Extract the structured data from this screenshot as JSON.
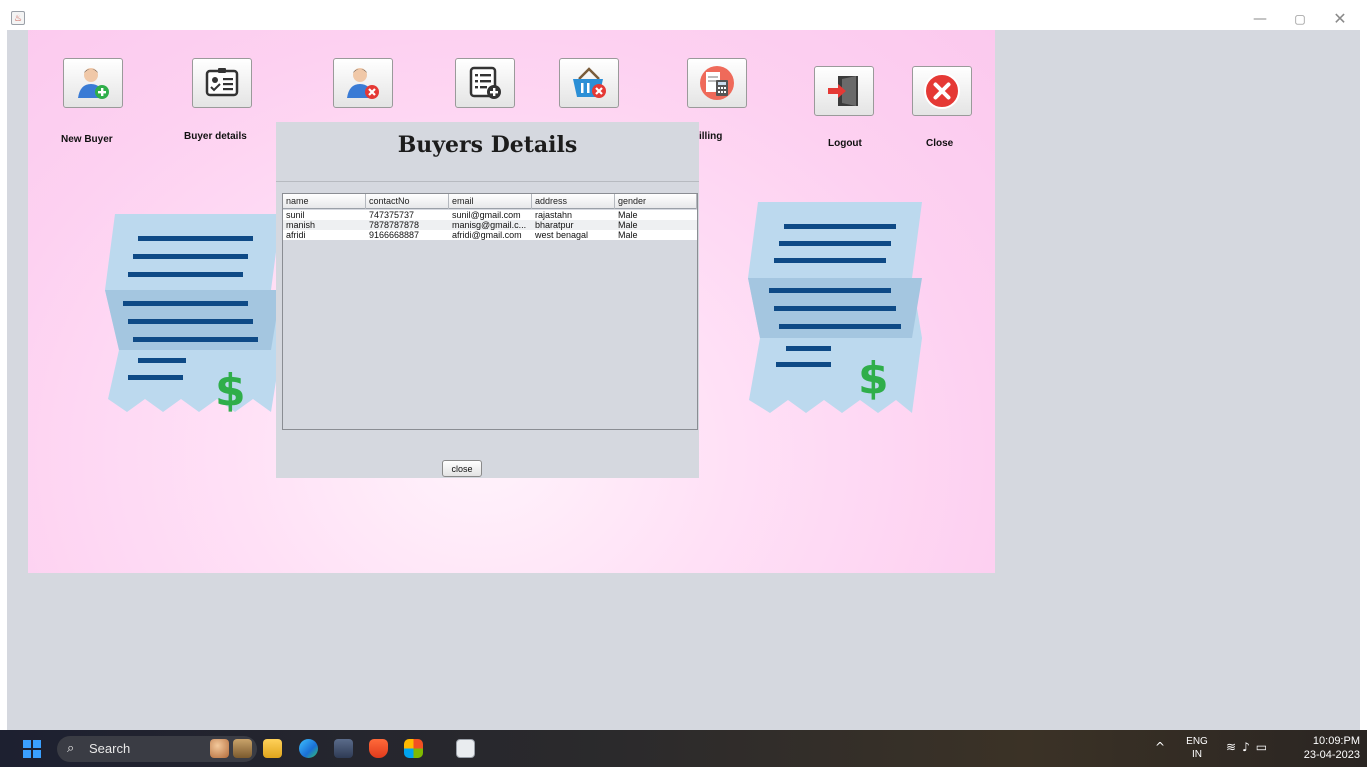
{
  "window": {
    "controls": {
      "minimize": "—",
      "maximize": "▢",
      "close": "✕"
    }
  },
  "toolbar": {
    "buttons": [
      {
        "id": "new-buyer",
        "label": "New Buyer",
        "icon": "add-user-icon"
      },
      {
        "id": "buyer-details",
        "label": "Buyer details",
        "icon": "id-card-icon"
      },
      {
        "id": "delete-buyer",
        "icon": "delete-user-icon"
      },
      {
        "id": "add-product",
        "icon": "add-list-icon"
      },
      {
        "id": "remove-product",
        "icon": "basket-remove-icon"
      },
      {
        "id": "billing",
        "label": "illing",
        "icon": "calculator-icon"
      },
      {
        "id": "logout",
        "label": "Logout",
        "icon": "logout-door-icon"
      },
      {
        "id": "close",
        "label": "Close",
        "icon": "close-circle-icon"
      }
    ]
  },
  "dialog": {
    "title": "Buyers Details",
    "table": {
      "columns": [
        "name",
        "contactNo",
        "email",
        "address",
        "gender"
      ],
      "rows": [
        [
          "sunil",
          "747375737",
          "sunil@gmail.com",
          "rajastahn",
          "Male"
        ],
        [
          "manish",
          "7878787878",
          "manisg@gmail.c...",
          "bharatpur",
          "Male"
        ],
        [
          "afridi",
          "9166668887",
          "afridi@gmail.com",
          "west benagal",
          "Male"
        ]
      ]
    },
    "close_label": "close"
  },
  "taskbar": {
    "search_label": "Search",
    "apps": [
      "people-icon",
      "files-icon",
      "folder-icon",
      "edge-icon",
      "store-icon",
      "brave-icon",
      "office-icon",
      "java-icon"
    ],
    "lang_line1": "ENG",
    "lang_line2": "IN",
    "time": "10:09:PM",
    "date": "23-04-2023"
  },
  "colors": {
    "panel_pink": "#fbc9ee",
    "receipt_blue": "#bcd9ee",
    "receipt_line": "#0e4a86",
    "dollar_green": "#2fae4a",
    "dialog_gray": "#d5d8df"
  }
}
